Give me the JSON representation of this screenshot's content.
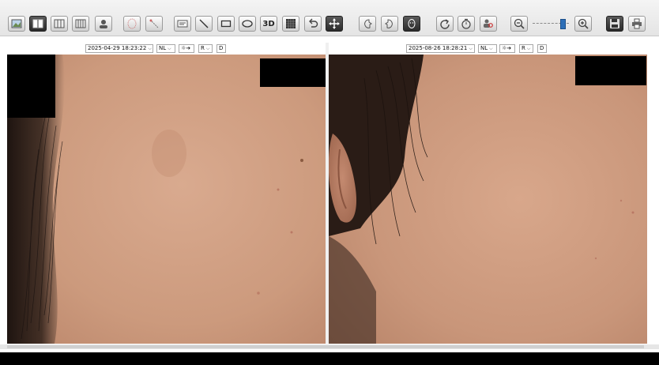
{
  "toolbar": {
    "buttons": [
      {
        "name": "image-view-icon"
      },
      {
        "name": "two-pane-layout-icon",
        "active": true
      },
      {
        "name": "three-pane-layout-icon"
      },
      {
        "name": "four-pane-layout-icon"
      },
      {
        "name": "person-profile-icon"
      },
      {
        "name": "face-mapping-icon"
      },
      {
        "name": "measure-tool-icon"
      },
      {
        "name": "id-card-icon"
      },
      {
        "name": "line-tool-icon"
      },
      {
        "name": "rectangle-tool-icon"
      },
      {
        "name": "ellipse-tool-icon"
      },
      {
        "name": "3d-view-icon",
        "label": "3D"
      },
      {
        "name": "grid-overlay-icon"
      },
      {
        "name": "undo-icon"
      },
      {
        "name": "move-pan-icon",
        "active": true
      },
      {
        "name": "face-left-icon"
      },
      {
        "name": "face-right-icon"
      },
      {
        "name": "face-front-icon"
      },
      {
        "name": "redo-icon"
      },
      {
        "name": "timer-icon"
      },
      {
        "name": "user-search-icon"
      },
      {
        "name": "zoom-out-icon"
      },
      {
        "name": "zoom-in-icon"
      },
      {
        "name": "save-icon"
      },
      {
        "name": "print-icon"
      }
    ],
    "zoom_level": 0.85
  },
  "panels": {
    "left": {
      "timestamp": "2025-04-29 18:23:22",
      "mode": "NL",
      "light_label": "☼➔",
      "side": "R",
      "view": "D"
    },
    "right": {
      "timestamp": "2025-08-26 18:28:21",
      "mode": "NL",
      "light_label": "☼➔",
      "side": "R",
      "view": "D"
    }
  },
  "colors": {
    "skin": "#c99478",
    "skin_light": "#d6a58a",
    "hair": "#2a1d18",
    "accent": "#2e6fb8"
  }
}
